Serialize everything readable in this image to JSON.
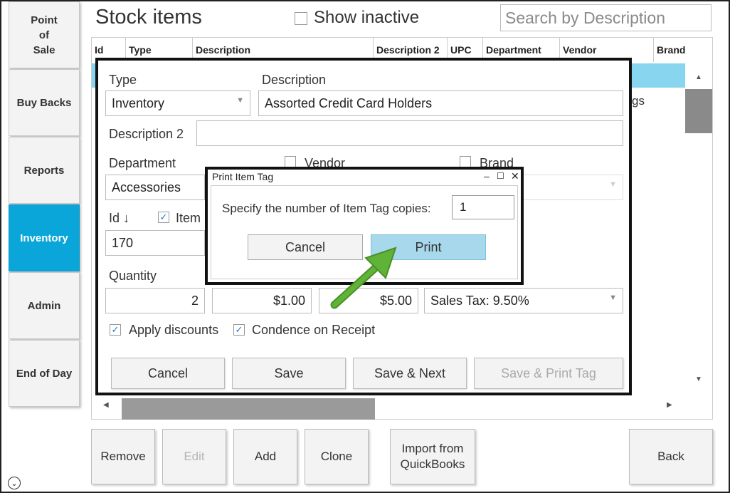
{
  "nav": {
    "items": [
      {
        "label": "Point\nof\nSale"
      },
      {
        "label": "Buy Backs"
      },
      {
        "label": "Reports"
      },
      {
        "label": "Inventory",
        "active": true
      },
      {
        "label": "Admin"
      },
      {
        "label": "End of Day"
      }
    ],
    "expand_icon": "⌄"
  },
  "header": {
    "title": "Stock items",
    "show_inactive_label": "Show inactive",
    "search_placeholder": "Search by Description"
  },
  "grid": {
    "columns": [
      "Id",
      "Type",
      "Description",
      "Description 2",
      "UPC",
      "Department",
      "Vendor",
      "Brand"
    ],
    "visible_partial_text": "gs"
  },
  "bottom_buttons": {
    "remove": "Remove",
    "edit": "Edit",
    "add": "Add",
    "clone": "Clone",
    "import": "Import from\nQuickBooks",
    "back": "Back"
  },
  "form": {
    "type_label": "Type",
    "type_value": "Inventory",
    "description_label": "Description",
    "description_value": "Assorted Credit Card Holders",
    "description2_label": "Description 2",
    "description2_value": "",
    "department_label": "Department",
    "department_value": "Accessories",
    "vendor_label": "Vendor",
    "brand_label": "Brand",
    "id_label": "Id ↓",
    "item_label": "Item",
    "id_value": "170",
    "quantity_label": "Quantity",
    "quantity_value": "2",
    "cost_value": "$1.00",
    "price_value": "$5.00",
    "tax_value": "Sales Tax: 9.50%",
    "apply_discounts_label": "Apply discounts",
    "condence_label": "Condence on Receipt",
    "buttons": {
      "cancel": "Cancel",
      "save": "Save",
      "save_next": "Save & Next",
      "save_print": "Save & Print Tag"
    }
  },
  "dialog": {
    "title": "Print Item Tag",
    "minimize": "–",
    "maximize": "☐",
    "close": "✕",
    "prompt": "Specify the number of Item Tag copies:",
    "copies_value": "1",
    "cancel": "Cancel",
    "print": "Print"
  },
  "colors": {
    "accent": "#0aa6d9",
    "selection": "#87d5ee",
    "print_button": "#a7d8ec",
    "arrow": "#5aa832"
  }
}
